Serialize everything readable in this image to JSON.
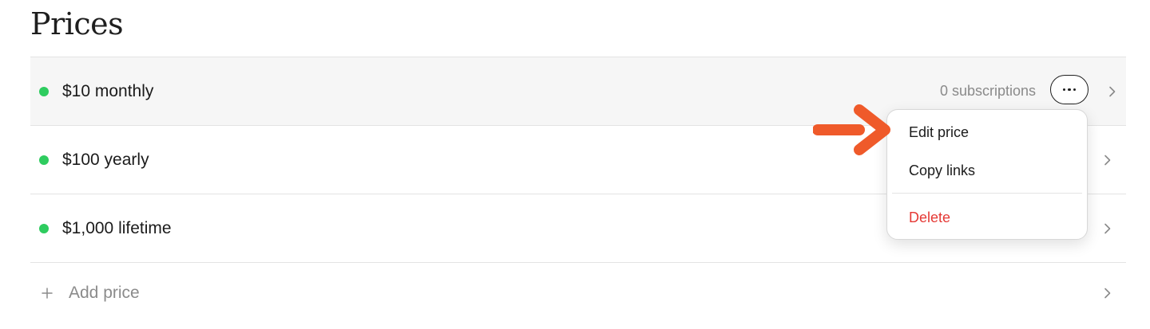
{
  "page": {
    "title": "Prices"
  },
  "colors": {
    "active_dot": "#2ecc5f",
    "delete": "#e53935",
    "arrow": "#ef5a2a"
  },
  "prices": [
    {
      "name": "$10 monthly",
      "subscriptions": "0 subscriptions",
      "status": "active"
    },
    {
      "name": "$100 yearly",
      "status": "active"
    },
    {
      "name": "$1,000 lifetime",
      "status": "active"
    }
  ],
  "add": {
    "label": "Add price",
    "icon": "plus-icon"
  },
  "menu": {
    "items": [
      "Edit price",
      "Copy links"
    ],
    "delete_label": "Delete"
  }
}
